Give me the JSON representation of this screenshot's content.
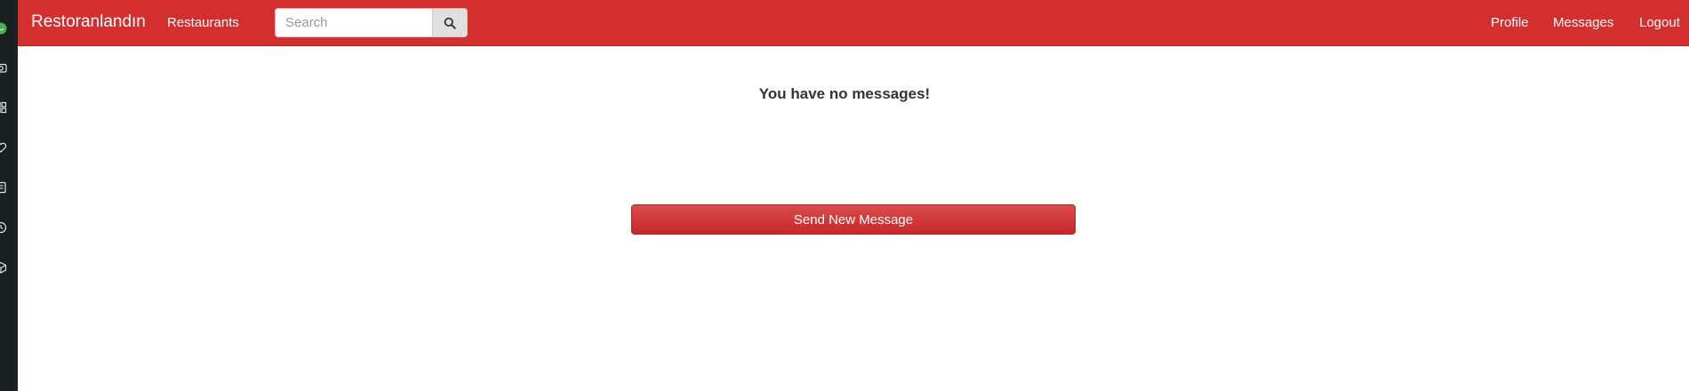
{
  "dock": {
    "icons": [
      "whatsapp-icon",
      "camera-icon",
      "grid-icon",
      "heart-icon",
      "note-icon",
      "clock-icon",
      "cube-icon"
    ]
  },
  "navbar": {
    "brand": "Restoranlandın",
    "restaurants_label": "Restaurants",
    "profile_label": "Profile",
    "messages_label": "Messages",
    "logout_label": "Logout",
    "search": {
      "placeholder": "Search",
      "value": ""
    },
    "color": "#d32f2f"
  },
  "main": {
    "empty_text": "You have no messages!",
    "send_button_label": "Send New Message"
  }
}
